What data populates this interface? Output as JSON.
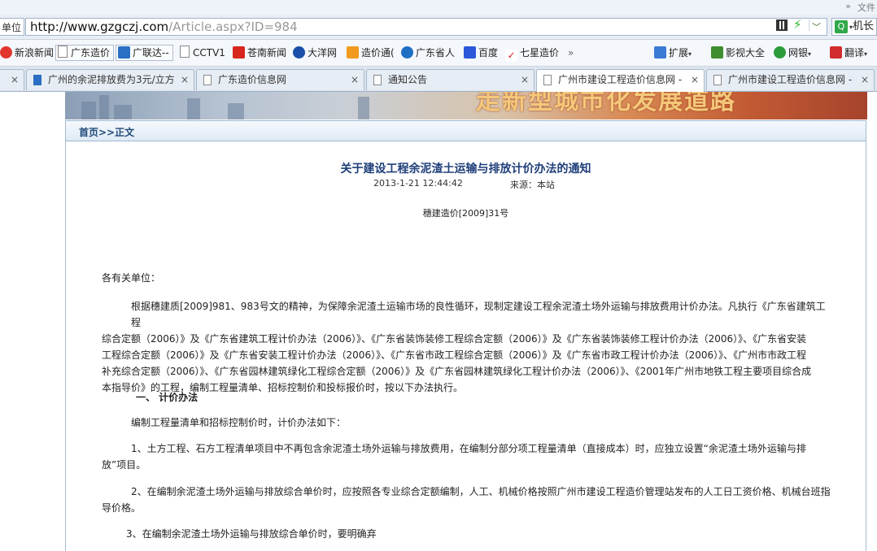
{
  "browser": {
    "chevron": "»",
    "more_menu": "文件",
    "unit_dropdown": "单位",
    "url_domain": "http://www.gzgczj.com",
    "url_path": "/Article.aspx?ID=984",
    "search_text": "机长"
  },
  "bookmarks": [
    {
      "label": "新浪新闻",
      "icon": "weibo-icon",
      "color": "#e2362d"
    },
    {
      "label": "广东造价",
      "icon": "page-icon",
      "color": "#ffffff"
    },
    {
      "label": "广联达--",
      "icon": "glodon-icon",
      "color": "#2a6fc4"
    },
    {
      "label": "CCTV1",
      "icon": "page-icon",
      "color": "#ffffff"
    },
    {
      "label": "苍南新闻",
      "icon": "news-icon",
      "color": "#d7261d"
    },
    {
      "label": "大洋网",
      "icon": "dayoo-icon",
      "color": "#1a4ea8"
    },
    {
      "label": "造价通(",
      "icon": "rss-icon",
      "color": "#f29a1f"
    },
    {
      "label": "广东省人",
      "icon": "gov-icon",
      "color": "#1d6fc4"
    },
    {
      "label": "百度",
      "icon": "baidu-icon",
      "color": "#2b57d9"
    },
    {
      "label": "七星造价",
      "icon": "check-icon",
      "color": "#d11f1f"
    },
    {
      "label": "»",
      "icon": "",
      "color": ""
    },
    {
      "label": "扩展",
      "icon": "grid-icon",
      "color": "#3a7bd5"
    },
    {
      "label": "影视大全",
      "icon": "play-icon",
      "color": "#3e8d2f"
    },
    {
      "label": "网银",
      "icon": "shield-icon",
      "color": "#2b9c3a"
    },
    {
      "label": "翻译",
      "icon": "translate-icon",
      "color": "#d12d2d"
    }
  ],
  "tabs": [
    {
      "label": "",
      "active": false
    },
    {
      "label": "广州的余泥排放费为3元/立方",
      "active": false
    },
    {
      "label": "广东造价信息网",
      "active": false
    },
    {
      "label": "通知公告",
      "active": false
    },
    {
      "label": "广州市建设工程造价信息网 -",
      "active": true
    },
    {
      "label": "广州市建设工程造价信息网 -",
      "active": false
    }
  ],
  "tab_close": "×",
  "banner": {
    "slogan": "走新型城市化发展道路"
  },
  "breadcrumb": "首页>>正文",
  "article": {
    "title": "关于建设工程余泥渣土运输与排放计价办法的通知",
    "datetime": "2013-1-21 12:44:42",
    "source": "来源：本站",
    "doc_number": "穗建造价[2009]31号",
    "salutation": "各有关单位：",
    "intro_lines": [
      "根据穗建质[2009]981、983号文的精神，为保障余泥渣土运输市场的良性循环，现制定建设工程余泥渣土场外运输与排放费用计价办法。凡执行《广东省建筑工程",
      "综合定额（2006）》及《广东省建筑工程计价办法（2006）》、《广东省装饰装修工程综合定额（2006）》及《广东省装饰装修工程计价办法（2006）》、《广东省安装",
      "工程综合定额（2006）》及《广东省安装工程计价办法（2006）》、《广东省市政工程综合定额（2006）》及《广东省市政工程计价办法（2006）》、《广州市市政工程",
      "补充综合定额（2006）》、《广东省园林建筑绿化工程综合定额（2006）》及《广东省园林建筑绿化工程计价办法（2006）》、《2001年广州市地铁工程主要项目综合成",
      "本指导价》的工程，编制工程量清单、招标控制价和投标报价时，按以下办法执行。"
    ],
    "section1_heading": "一、 计价办法",
    "section1_lead": "编制工程量清单和招标控制价时，计价办法如下：",
    "item1_lines": [
      "1、土方工程、石方工程清单项目中不再包含余泥渣土场外运输与排放费用，在编制分部分项工程量清单（直接成本）时，应独立设置“余泥渣土场外运输与排",
      "放”项目。"
    ],
    "item2_lines": [
      "2、在编制余泥渣土场外运输与排放综合单价时，应按照各专业综合定额编制，人工、机械价格按照广州市建设工程造价管理站发布的人工日工资价格、机械台班指",
      "导价格。"
    ],
    "item3_line": "3、在编制余泥渣土场外运输与排放综合单价时，要明确弃"
  }
}
